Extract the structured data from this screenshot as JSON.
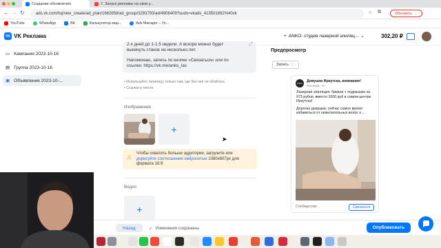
{
  "browser": {
    "tabs": [
      {
        "label": "Создание объявления",
        "active": true
      },
      {
        "label": "7. Запуск рекламы на свои у...",
        "active": false
      }
    ],
    "url": "ads.vk.com/hq/new_create/ad_plan/1662658/ad_group/3293793/ad/4906409?sudo=vkads_413501692%40vk",
    "update_label": "Обновить",
    "bookmarks": [
      "YouTube",
      "WhatsApp",
      "ВК",
      "Калькулятор мар...",
      "Ads Manager – Уп..."
    ]
  },
  "app": {
    "logo_text": "VK Реклама",
    "cabinet_label": "ANKO- студия лазерной эпиляц...",
    "balance": "302,20 ₽"
  },
  "sidebar": {
    "items": [
      {
        "label": "Кампания 2023-10-16"
      },
      {
        "label": "Группа 2023-10-16"
      },
      {
        "label": "Объявление 2023-10-..."
      }
    ]
  },
  "editor": {
    "text_lines": [
      "2-х дней до 1-1.5 недели. А вскоре можно будет",
      "выкинуть станок на несколько лет.",
      "",
      "Напоминаю, запись по кнопке «Связаться» или по",
      "ссылке: https://vk.me/anko_las"
    ],
    "hints": [
      "Используйте латиницу только там, где без неё не обойтись",
      "Ссылки в тексте"
    ],
    "images_label": "Изображения",
    "warning_pre": "Чтобы охватить больше аудитории, загрузите или",
    "warning_link": "дорисуйте соотношение нейросетью",
    "warning_post": "1080x607px для",
    "warning_end": "формата 16:9",
    "video_label": "Видео"
  },
  "preview": {
    "title": "Предпросмотр",
    "tab_label": "Запись",
    "card": {
      "avatar_text": "ANKO",
      "name": "Девушки Иркутска, внимание!",
      "subtitle": "Реклама · 0+",
      "text_1": "Лазерная эпиляция: бикини + подмышки за 973 рубля, вместо 2000 руб в самом центре Иркутска!",
      "text_2": "Дорогие девушки, сейчас самое время избавиться от нежелательных волос к ...",
      "footer_label": "Сообщество",
      "cta_label": "Связаться"
    }
  },
  "bottom": {
    "back_label": "Назад",
    "saved_label": "Изменения сохранены",
    "publish_label": "Опубликовать"
  },
  "colors": {
    "accent": "#0077ff",
    "warning_bg": "#fdf3dd",
    "link": "#2a6ee0"
  }
}
